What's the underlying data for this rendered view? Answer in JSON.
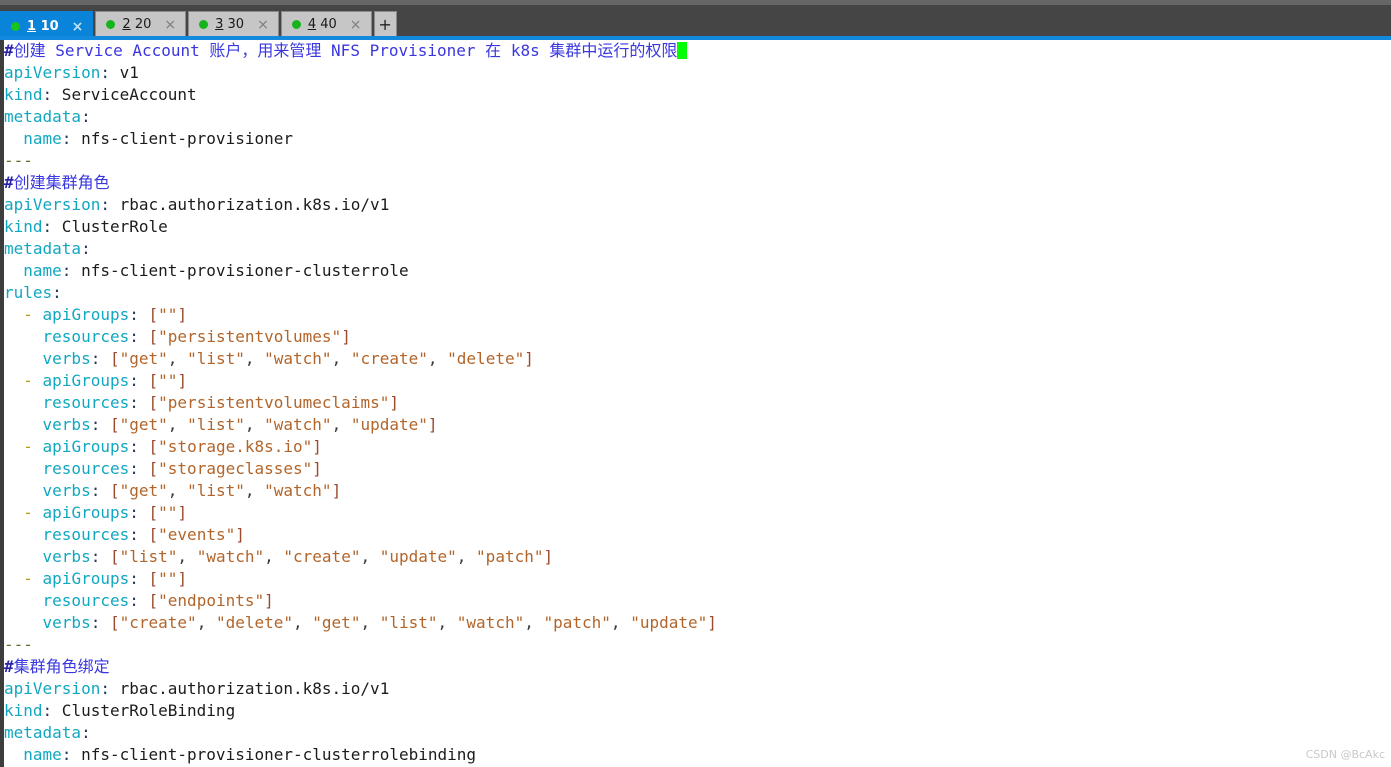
{
  "window": {
    "accent_color": "#1389dd",
    "tabbar_bg": "#454545",
    "terminal_bg": "#ffffff"
  },
  "tabbar": {
    "new_tab_label": "+",
    "close_glyph": "×",
    "tabs": [
      {
        "mnemonic": "1",
        "title": "10",
        "active": true,
        "status_color": "#19c41f"
      },
      {
        "mnemonic": "2",
        "title": "20",
        "active": false,
        "status_color": "#16b41c"
      },
      {
        "mnemonic": "3",
        "title": "30",
        "active": false,
        "status_color": "#16b41c"
      },
      {
        "mnemonic": "4",
        "title": "40",
        "active": false,
        "status_color": "#16b41c"
      }
    ]
  },
  "editor": {
    "cursor_color": "#00ff00",
    "lines": [
      {
        "id": 1,
        "tokens": [
          {
            "t": "hash",
            "v": "#"
          },
          {
            "t": "cmt",
            "v": "创建 "
          },
          {
            "t": "cmt",
            "v": "Service Account "
          },
          {
            "t": "cmt",
            "v": "账户，用来管理 "
          },
          {
            "t": "cmt",
            "v": "NFS Provisioner "
          },
          {
            "t": "cmt",
            "v": "在 "
          },
          {
            "t": "cmt",
            "v": "k8s "
          },
          {
            "t": "cmt",
            "v": "集群中运行的权限"
          },
          {
            "t": "cursor",
            "v": " "
          }
        ]
      },
      {
        "id": 2,
        "tokens": [
          {
            "t": "key",
            "v": "apiVersion"
          },
          {
            "t": "punct",
            "v": ":"
          },
          {
            "t": "val",
            "v": " v1"
          }
        ]
      },
      {
        "id": 3,
        "tokens": [
          {
            "t": "key",
            "v": "kind"
          },
          {
            "t": "punct",
            "v": ":"
          },
          {
            "t": "val",
            "v": " ServiceAccount"
          }
        ]
      },
      {
        "id": 4,
        "tokens": [
          {
            "t": "key",
            "v": "metadata"
          },
          {
            "t": "punct",
            "v": ":"
          }
        ]
      },
      {
        "id": 5,
        "tokens": [
          {
            "t": "val",
            "v": "  "
          },
          {
            "t": "key",
            "v": "name"
          },
          {
            "t": "punct",
            "v": ":"
          },
          {
            "t": "val",
            "v": " nfs-client-provisioner"
          }
        ]
      },
      {
        "id": 6,
        "tokens": [
          {
            "t": "sep",
            "v": "---"
          }
        ]
      },
      {
        "id": 7,
        "tokens": [
          {
            "t": "hash",
            "v": "#"
          },
          {
            "t": "cmt",
            "v": "创建集群角色"
          }
        ]
      },
      {
        "id": 8,
        "tokens": [
          {
            "t": "key",
            "v": "apiVersion"
          },
          {
            "t": "punct",
            "v": ":"
          },
          {
            "t": "val",
            "v": " rbac.authorization.k8s.io/v1"
          }
        ]
      },
      {
        "id": 9,
        "tokens": [
          {
            "t": "key",
            "v": "kind"
          },
          {
            "t": "punct",
            "v": ":"
          },
          {
            "t": "val",
            "v": " ClusterRole"
          }
        ]
      },
      {
        "id": 10,
        "tokens": [
          {
            "t": "key",
            "v": "metadata"
          },
          {
            "t": "punct",
            "v": ":"
          }
        ]
      },
      {
        "id": 11,
        "tokens": [
          {
            "t": "val",
            "v": "  "
          },
          {
            "t": "key",
            "v": "name"
          },
          {
            "t": "punct",
            "v": ":"
          },
          {
            "t": "val",
            "v": " nfs-client-provisioner-clusterrole"
          }
        ]
      },
      {
        "id": 12,
        "tokens": [
          {
            "t": "key",
            "v": "rules"
          },
          {
            "t": "punct",
            "v": ":"
          }
        ]
      },
      {
        "id": 13,
        "tokens": [
          {
            "t": "val",
            "v": "  "
          },
          {
            "t": "dash",
            "v": "-"
          },
          {
            "t": "val",
            "v": " "
          },
          {
            "t": "key",
            "v": "apiGroups"
          },
          {
            "t": "punct",
            "v": ":"
          },
          {
            "t": "val",
            "v": " "
          },
          {
            "t": "brk",
            "v": "["
          },
          {
            "t": "str",
            "v": "\"\""
          },
          {
            "t": "brk",
            "v": "]"
          }
        ]
      },
      {
        "id": 14,
        "tokens": [
          {
            "t": "val",
            "v": "    "
          },
          {
            "t": "key",
            "v": "resources"
          },
          {
            "t": "punct",
            "v": ":"
          },
          {
            "t": "val",
            "v": " "
          },
          {
            "t": "brk",
            "v": "["
          },
          {
            "t": "str",
            "v": "\"persistentvolumes\""
          },
          {
            "t": "brk",
            "v": "]"
          }
        ]
      },
      {
        "id": 15,
        "tokens": [
          {
            "t": "val",
            "v": "    "
          },
          {
            "t": "key",
            "v": "verbs"
          },
          {
            "t": "punct",
            "v": ":"
          },
          {
            "t": "val",
            "v": " "
          },
          {
            "t": "brk",
            "v": "["
          },
          {
            "t": "str",
            "v": "\"get\""
          },
          {
            "t": "comma",
            "v": ", "
          },
          {
            "t": "str",
            "v": "\"list\""
          },
          {
            "t": "comma",
            "v": ", "
          },
          {
            "t": "str",
            "v": "\"watch\""
          },
          {
            "t": "comma",
            "v": ", "
          },
          {
            "t": "str",
            "v": "\"create\""
          },
          {
            "t": "comma",
            "v": ", "
          },
          {
            "t": "str",
            "v": "\"delete\""
          },
          {
            "t": "brk",
            "v": "]"
          }
        ]
      },
      {
        "id": 16,
        "tokens": [
          {
            "t": "val",
            "v": "  "
          },
          {
            "t": "dash",
            "v": "-"
          },
          {
            "t": "val",
            "v": " "
          },
          {
            "t": "key",
            "v": "apiGroups"
          },
          {
            "t": "punct",
            "v": ":"
          },
          {
            "t": "val",
            "v": " "
          },
          {
            "t": "brk",
            "v": "["
          },
          {
            "t": "str",
            "v": "\"\""
          },
          {
            "t": "brk",
            "v": "]"
          }
        ]
      },
      {
        "id": 17,
        "tokens": [
          {
            "t": "val",
            "v": "    "
          },
          {
            "t": "key",
            "v": "resources"
          },
          {
            "t": "punct",
            "v": ":"
          },
          {
            "t": "val",
            "v": " "
          },
          {
            "t": "brk",
            "v": "["
          },
          {
            "t": "str",
            "v": "\"persistentvolumeclaims\""
          },
          {
            "t": "brk",
            "v": "]"
          }
        ]
      },
      {
        "id": 18,
        "tokens": [
          {
            "t": "val",
            "v": "    "
          },
          {
            "t": "key",
            "v": "verbs"
          },
          {
            "t": "punct",
            "v": ":"
          },
          {
            "t": "val",
            "v": " "
          },
          {
            "t": "brk",
            "v": "["
          },
          {
            "t": "str",
            "v": "\"get\""
          },
          {
            "t": "comma",
            "v": ", "
          },
          {
            "t": "str",
            "v": "\"list\""
          },
          {
            "t": "comma",
            "v": ", "
          },
          {
            "t": "str",
            "v": "\"watch\""
          },
          {
            "t": "comma",
            "v": ", "
          },
          {
            "t": "str",
            "v": "\"update\""
          },
          {
            "t": "brk",
            "v": "]"
          }
        ]
      },
      {
        "id": 19,
        "tokens": [
          {
            "t": "val",
            "v": "  "
          },
          {
            "t": "dash",
            "v": "-"
          },
          {
            "t": "val",
            "v": " "
          },
          {
            "t": "key",
            "v": "apiGroups"
          },
          {
            "t": "punct",
            "v": ":"
          },
          {
            "t": "val",
            "v": " "
          },
          {
            "t": "brk",
            "v": "["
          },
          {
            "t": "str",
            "v": "\"storage.k8s.io\""
          },
          {
            "t": "brk",
            "v": "]"
          }
        ]
      },
      {
        "id": 20,
        "tokens": [
          {
            "t": "val",
            "v": "    "
          },
          {
            "t": "key",
            "v": "resources"
          },
          {
            "t": "punct",
            "v": ":"
          },
          {
            "t": "val",
            "v": " "
          },
          {
            "t": "brk",
            "v": "["
          },
          {
            "t": "str",
            "v": "\"storageclasses\""
          },
          {
            "t": "brk",
            "v": "]"
          }
        ]
      },
      {
        "id": 21,
        "tokens": [
          {
            "t": "val",
            "v": "    "
          },
          {
            "t": "key",
            "v": "verbs"
          },
          {
            "t": "punct",
            "v": ":"
          },
          {
            "t": "val",
            "v": " "
          },
          {
            "t": "brk",
            "v": "["
          },
          {
            "t": "str",
            "v": "\"get\""
          },
          {
            "t": "comma",
            "v": ", "
          },
          {
            "t": "str",
            "v": "\"list\""
          },
          {
            "t": "comma",
            "v": ", "
          },
          {
            "t": "str",
            "v": "\"watch\""
          },
          {
            "t": "brk",
            "v": "]"
          }
        ]
      },
      {
        "id": 22,
        "tokens": [
          {
            "t": "val",
            "v": "  "
          },
          {
            "t": "dash",
            "v": "-"
          },
          {
            "t": "val",
            "v": " "
          },
          {
            "t": "key",
            "v": "apiGroups"
          },
          {
            "t": "punct",
            "v": ":"
          },
          {
            "t": "val",
            "v": " "
          },
          {
            "t": "brk",
            "v": "["
          },
          {
            "t": "str",
            "v": "\"\""
          },
          {
            "t": "brk",
            "v": "]"
          }
        ]
      },
      {
        "id": 23,
        "tokens": [
          {
            "t": "val",
            "v": "    "
          },
          {
            "t": "key",
            "v": "resources"
          },
          {
            "t": "punct",
            "v": ":"
          },
          {
            "t": "val",
            "v": " "
          },
          {
            "t": "brk",
            "v": "["
          },
          {
            "t": "str",
            "v": "\"events\""
          },
          {
            "t": "brk",
            "v": "]"
          }
        ]
      },
      {
        "id": 24,
        "tokens": [
          {
            "t": "val",
            "v": "    "
          },
          {
            "t": "key",
            "v": "verbs"
          },
          {
            "t": "punct",
            "v": ":"
          },
          {
            "t": "val",
            "v": " "
          },
          {
            "t": "brk",
            "v": "["
          },
          {
            "t": "str",
            "v": "\"list\""
          },
          {
            "t": "comma",
            "v": ", "
          },
          {
            "t": "str",
            "v": "\"watch\""
          },
          {
            "t": "comma",
            "v": ", "
          },
          {
            "t": "str",
            "v": "\"create\""
          },
          {
            "t": "comma",
            "v": ", "
          },
          {
            "t": "str",
            "v": "\"update\""
          },
          {
            "t": "comma",
            "v": ", "
          },
          {
            "t": "str",
            "v": "\"patch\""
          },
          {
            "t": "brk",
            "v": "]"
          }
        ]
      },
      {
        "id": 25,
        "tokens": [
          {
            "t": "val",
            "v": "  "
          },
          {
            "t": "dash",
            "v": "-"
          },
          {
            "t": "val",
            "v": " "
          },
          {
            "t": "key",
            "v": "apiGroups"
          },
          {
            "t": "punct",
            "v": ":"
          },
          {
            "t": "val",
            "v": " "
          },
          {
            "t": "brk",
            "v": "["
          },
          {
            "t": "str",
            "v": "\"\""
          },
          {
            "t": "brk",
            "v": "]"
          }
        ]
      },
      {
        "id": 26,
        "tokens": [
          {
            "t": "val",
            "v": "    "
          },
          {
            "t": "key",
            "v": "resources"
          },
          {
            "t": "punct",
            "v": ":"
          },
          {
            "t": "val",
            "v": " "
          },
          {
            "t": "brk",
            "v": "["
          },
          {
            "t": "str",
            "v": "\"endpoints\""
          },
          {
            "t": "brk",
            "v": "]"
          }
        ]
      },
      {
        "id": 27,
        "tokens": [
          {
            "t": "val",
            "v": "    "
          },
          {
            "t": "key",
            "v": "verbs"
          },
          {
            "t": "punct",
            "v": ":"
          },
          {
            "t": "val",
            "v": " "
          },
          {
            "t": "brk",
            "v": "["
          },
          {
            "t": "str",
            "v": "\"create\""
          },
          {
            "t": "comma",
            "v": ", "
          },
          {
            "t": "str",
            "v": "\"delete\""
          },
          {
            "t": "comma",
            "v": ", "
          },
          {
            "t": "str",
            "v": "\"get\""
          },
          {
            "t": "comma",
            "v": ", "
          },
          {
            "t": "str",
            "v": "\"list\""
          },
          {
            "t": "comma",
            "v": ", "
          },
          {
            "t": "str",
            "v": "\"watch\""
          },
          {
            "t": "comma",
            "v": ", "
          },
          {
            "t": "str",
            "v": "\"patch\""
          },
          {
            "t": "comma",
            "v": ", "
          },
          {
            "t": "str",
            "v": "\"update\""
          },
          {
            "t": "brk",
            "v": "]"
          }
        ]
      },
      {
        "id": 28,
        "tokens": [
          {
            "t": "sep",
            "v": "---"
          }
        ]
      },
      {
        "id": 29,
        "tokens": [
          {
            "t": "hash",
            "v": "#"
          },
          {
            "t": "cmt",
            "v": "集群角色绑定"
          }
        ]
      },
      {
        "id": 30,
        "tokens": [
          {
            "t": "key",
            "v": "apiVersion"
          },
          {
            "t": "punct",
            "v": ":"
          },
          {
            "t": "val",
            "v": " rbac.authorization.k8s.io/v1"
          }
        ]
      },
      {
        "id": 31,
        "tokens": [
          {
            "t": "key",
            "v": "kind"
          },
          {
            "t": "punct",
            "v": ":"
          },
          {
            "t": "val",
            "v": " ClusterRoleBinding"
          }
        ]
      },
      {
        "id": 32,
        "tokens": [
          {
            "t": "key",
            "v": "metadata"
          },
          {
            "t": "punct",
            "v": ":"
          }
        ]
      },
      {
        "id": 33,
        "tokens": [
          {
            "t": "val",
            "v": "  "
          },
          {
            "t": "key",
            "v": "name"
          },
          {
            "t": "punct",
            "v": ":"
          },
          {
            "t": "val",
            "v": " nfs-client-provisioner-clusterrolebinding"
          }
        ]
      }
    ]
  },
  "watermark": {
    "text": "CSDN @BcAkc"
  }
}
